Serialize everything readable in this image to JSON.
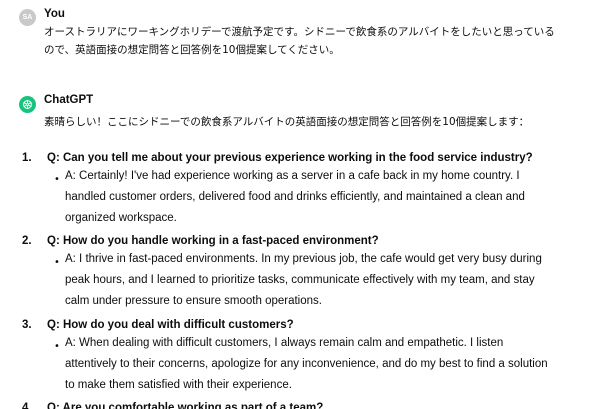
{
  "user_message": {
    "avatar_initials": "SA",
    "author": "You",
    "text": "オーストラリアにワーキングホリデーで渡航予定です。シドニーで飲食系のアルバイトをしたいと思っているので、英語面接の想定問答と回答例を10個提案してください。"
  },
  "assistant_message": {
    "author": "ChatGPT",
    "intro": "素晴らしい！ここにシドニーでの飲食系アルバイトの英語面接の想定問答と回答例を10個提案します：",
    "items": [
      {
        "number": "1.",
        "question": "Q: Can you tell me about your previous experience working in the food service industry?",
        "answer": "A: Certainly! I've had experience working as a server in a cafe back in my home country. I handled customer orders, delivered food and drinks efficiently, and maintained a clean and organized workspace."
      },
      {
        "number": "2.",
        "question": "Q: How do you handle working in a fast-paced environment?",
        "answer": "A: I thrive in fast-paced environments. In my previous job, the cafe would get very busy during peak hours, and I learned to prioritize tasks, communicate effectively with my team, and stay calm under pressure to ensure smooth operations."
      },
      {
        "number": "3.",
        "question": "Q: How do you deal with difficult customers?",
        "answer": "A: When dealing with difficult customers, I always remain calm and empathetic. I listen attentively to their concerns, apologize for any inconvenience, and do my best to find a solution to make them satisfied with their experience."
      },
      {
        "number": "4.",
        "question": "Q: Are you comfortable working as part of a team?",
        "answer": ""
      }
    ]
  },
  "colors": {
    "gpt_avatar": "#19c37d",
    "user_avatar": "#c9c9cc",
    "text": "#0d0d0d"
  }
}
